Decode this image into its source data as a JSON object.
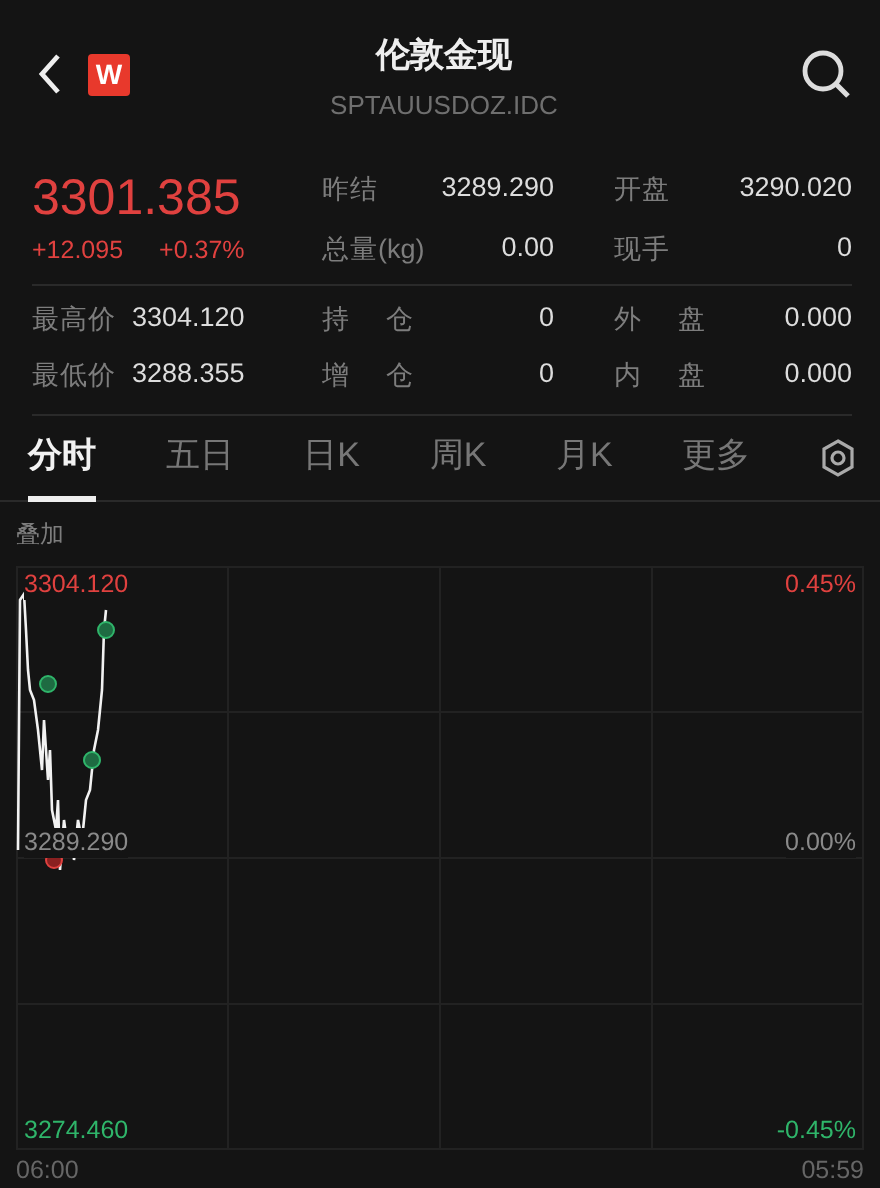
{
  "header": {
    "title": "伦敦金现",
    "code": "SPTAUUSDOZ.IDC",
    "logo": "W"
  },
  "quote": {
    "price": "3301.385",
    "change": "+12.095",
    "change_pct": "+0.37%"
  },
  "stats_top": [
    [
      {
        "label": "昨结",
        "value": "3289.290"
      },
      {
        "label": "开盘",
        "value": "3290.020"
      }
    ],
    [
      {
        "label": "总量(kg)",
        "value": "0.00"
      },
      {
        "label": "现手",
        "value": "0"
      }
    ]
  ],
  "stats_bottom": [
    [
      {
        "label": "最高价",
        "value": "3304.120"
      },
      {
        "label": "持 仓",
        "value": "0"
      },
      {
        "label": "外 盘",
        "value": "0.000"
      }
    ],
    [
      {
        "label": "最低价",
        "value": "3288.355"
      },
      {
        "label": "增 仓",
        "value": "0"
      },
      {
        "label": "内 盘",
        "value": "0.000"
      }
    ]
  ],
  "tabs": [
    {
      "label": "分时",
      "selected": true
    },
    {
      "label": "五日",
      "selected": false
    },
    {
      "label": "日K",
      "selected": false
    },
    {
      "label": "周K",
      "selected": false
    },
    {
      "label": "月K",
      "selected": false
    },
    {
      "label": "更多",
      "selected": false
    }
  ],
  "chart": {
    "overlay_label": "叠加",
    "y_labels": [
      {
        "kind": "high",
        "price": "3304.120",
        "percent": "0.45%"
      },
      {
        "kind": "mid",
        "price": "3289.290",
        "percent": "0.00%"
      },
      {
        "kind": "low",
        "price": "3274.460",
        "percent": "-0.45%"
      }
    ],
    "time_start": "06:00",
    "time_end": "05:59"
  }
}
